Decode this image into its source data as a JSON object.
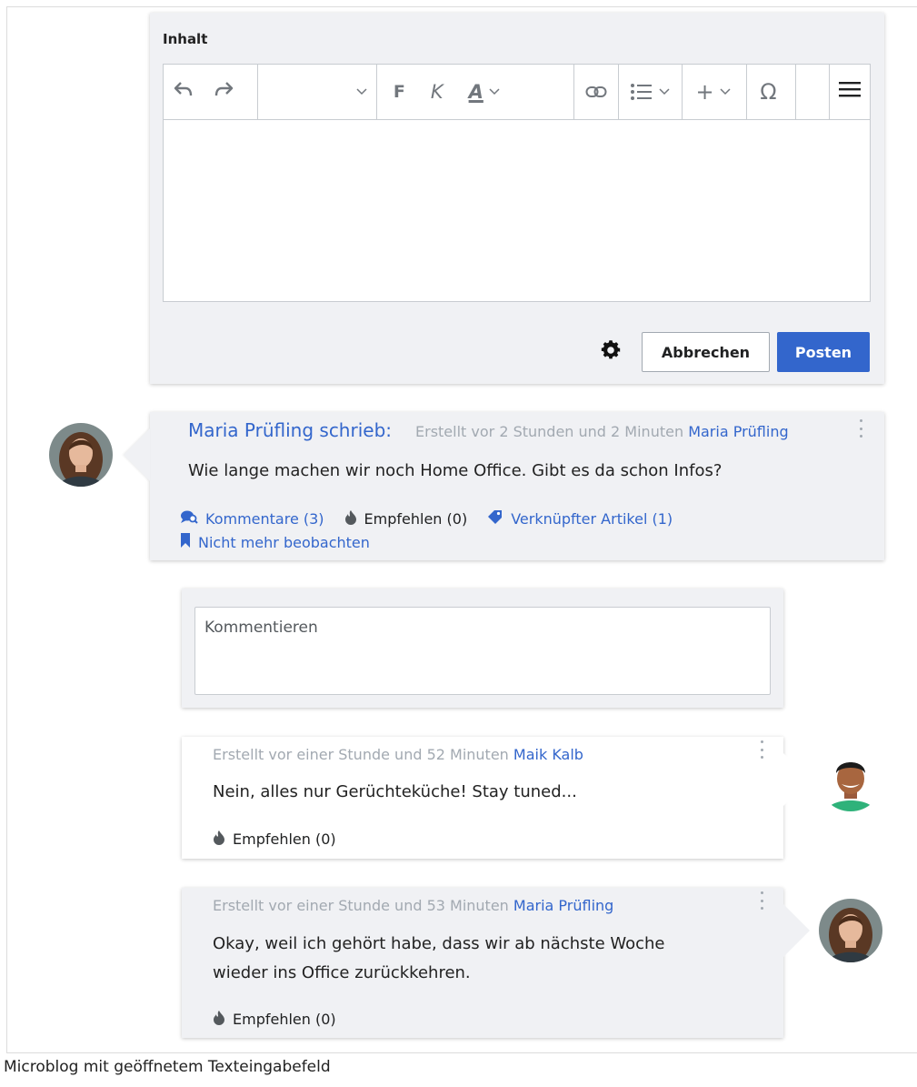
{
  "editor": {
    "label": "Inhalt",
    "toolbar": {
      "undo": "↶",
      "redo": "↷",
      "bold": "F",
      "italic": "K",
      "color": "A",
      "link": "🔗",
      "list": "☰",
      "insert": "+",
      "special": "Ω",
      "menu": "≡",
      "chevron": "⌄"
    },
    "cancel_label": "Abbrechen",
    "post_label": "Posten"
  },
  "post": {
    "author_heading": "Maria Prüfling schrieb:",
    "created": "Erstellt vor 2 Stunden und 2 Minuten",
    "author_link": "Maria Prüfling",
    "text": "Wie lange machen wir noch Home Office. Gibt es da schon Infos?",
    "actions": {
      "comments": "Kommentare (3)",
      "recommend": "Empfehlen (0)",
      "linked": "Verknüpfter Artikel (1)",
      "unwatch": "Nicht mehr beobachten"
    }
  },
  "comment_input": {
    "placeholder": "Kommentieren"
  },
  "replies": [
    {
      "created": "Erstellt vor einer Stunde und 52 Minuten",
      "author": "Maik Kalb",
      "text_lines": [
        "Nein, alles nur Gerüchteküche! Stay tuned..."
      ],
      "recommend": "Empfehlen (0)"
    },
    {
      "created": "Erstellt vor einer Stunde und 53 Minuten",
      "author": "Maria Prüfling",
      "text_lines": [
        "Okay, weil ich gehört habe, dass wir ab nächste Woche",
        "wieder ins Office zurückkehren."
      ],
      "recommend": "Empfehlen (0)"
    }
  ],
  "caption": "Microblog mit geöffnetem Texteingabefeld",
  "colors": {
    "accent": "#3366cc",
    "card_bg": "#f0f1f4",
    "meta_grey": "#a2a9b1"
  }
}
